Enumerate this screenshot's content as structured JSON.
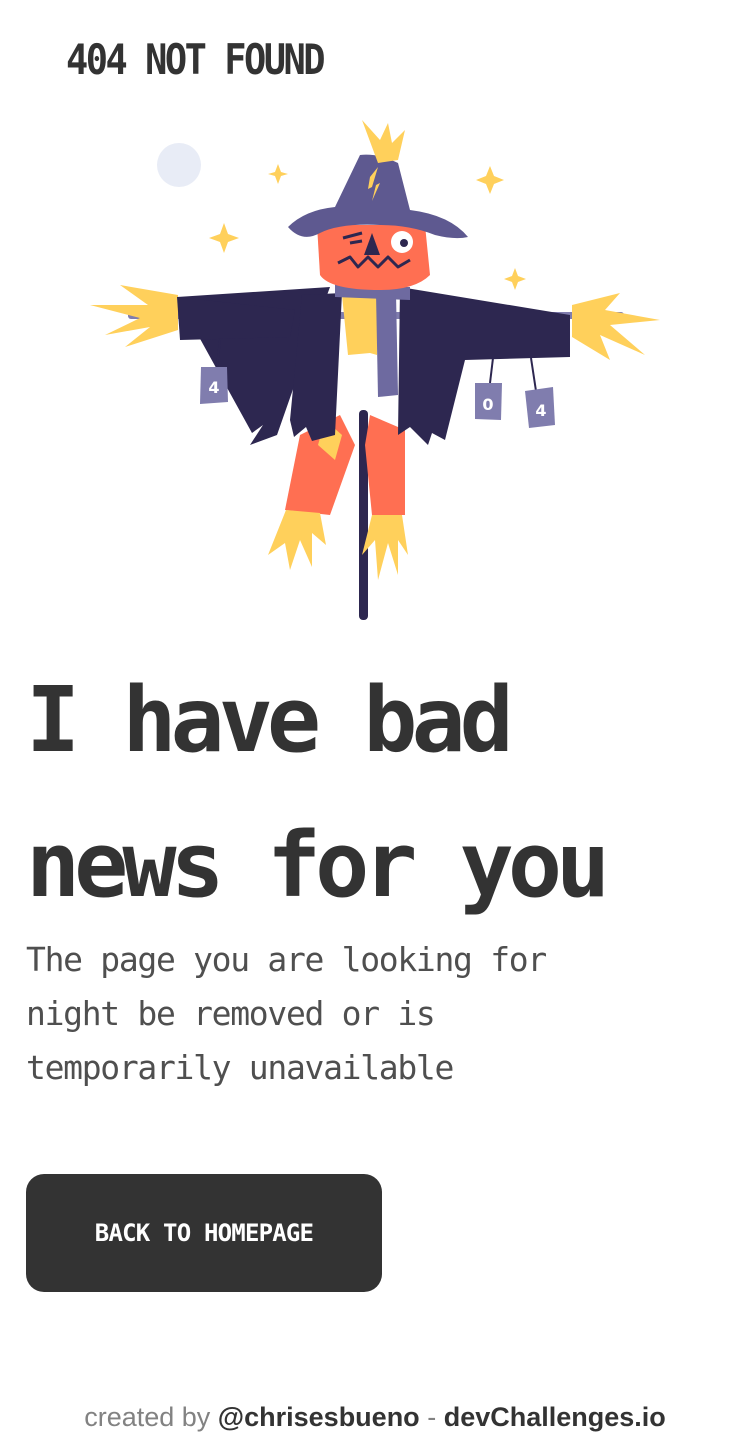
{
  "header": {
    "title": "404 NOT FOUND"
  },
  "illustration": {
    "can_labels": [
      "4",
      "0",
      "4"
    ],
    "colors": {
      "hat": "#5e5990",
      "coat": "#2d2750",
      "face": "#ff6f52",
      "straw": "#ffd05b",
      "scarf": "#6e6aa0",
      "moon": "#e8ecf6",
      "can": "#807dae",
      "pole": "#2d2750"
    }
  },
  "main": {
    "headline_lines": [
      "I have bad",
      "news for you"
    ],
    "message_lines": [
      "The page you are looking for",
      "night be removed or is",
      "temporarily unavailable"
    ],
    "button_label": "BACK TO HOMEPAGE"
  },
  "footer": {
    "prefix": "created by",
    "author": "@chrisesbueno",
    "separator": "-",
    "site": "devChallenges.io"
  }
}
